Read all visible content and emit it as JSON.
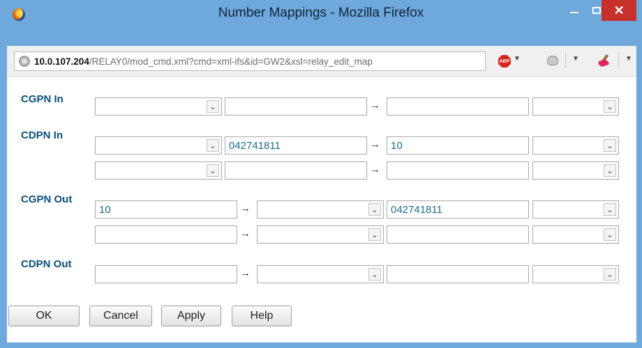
{
  "window": {
    "title": "Number Mappings - Mozilla Firefox",
    "close_glyph": "✕"
  },
  "urlbar": {
    "host": "10.0.107.204",
    "path": "/RELAY0/mod_cmd.xml?cmd=xml-ifs&id=GW2&xsl=relay_edit_map",
    "abp_text": "ABP"
  },
  "arrow_glyph": "→",
  "dropdown_glyph": "⌄",
  "sections": {
    "cgpn_in": {
      "label": "CGPN In",
      "rows": [
        {
          "select_in": "",
          "match": "",
          "replace": "",
          "select_out": ""
        }
      ]
    },
    "cdpn_in": {
      "label": "CDPN In",
      "rows": [
        {
          "select_in": "",
          "match": "042741811",
          "replace": "10",
          "select_out": ""
        },
        {
          "select_in": "",
          "match": "",
          "replace": "",
          "select_out": ""
        }
      ]
    },
    "cgpn_out": {
      "label": "CGPN Out",
      "rows": [
        {
          "match": "10",
          "select_in": "",
          "replace": "042741811",
          "select_out": ""
        },
        {
          "match": "",
          "select_in": "",
          "replace": "",
          "select_out": ""
        }
      ]
    },
    "cdpn_out": {
      "label": "CDPN Out",
      "rows": [
        {
          "match": "",
          "select_in": "",
          "replace": "",
          "select_out": ""
        }
      ]
    }
  },
  "buttons": {
    "ok": "OK",
    "cancel": "Cancel",
    "apply": "Apply",
    "help": "Help"
  }
}
